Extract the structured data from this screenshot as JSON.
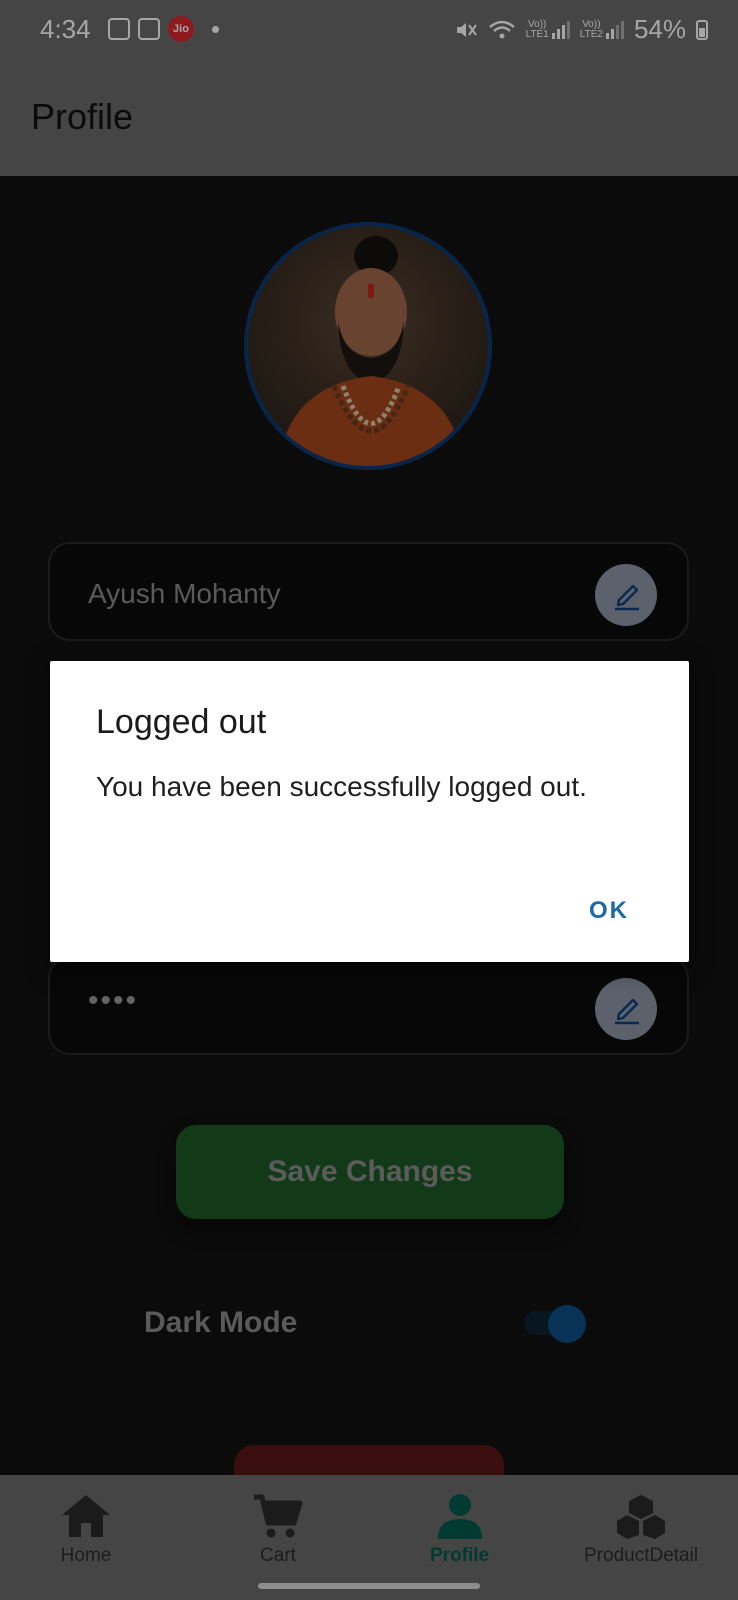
{
  "status_bar": {
    "time": "4:34",
    "battery_percent": "54%",
    "network_1_top": "Vo))",
    "network_1_bottom": "LTE1",
    "network_2_top": "Vo))",
    "network_2_bottom": "LTE2",
    "carrier_badge": "Jio"
  },
  "header": {
    "title": "Profile"
  },
  "profile": {
    "name_value": "Ayush Mohanty",
    "password_masked": "••••"
  },
  "actions": {
    "save_label": "Save Changes"
  },
  "settings": {
    "dark_mode_label": "Dark Mode",
    "dark_mode_on": true
  },
  "dialog": {
    "title": "Logged out",
    "message": "You have been successfully logged out.",
    "ok_label": "OK"
  },
  "bottom_nav": {
    "items": [
      {
        "label": "Home",
        "icon": "home-icon",
        "active": false
      },
      {
        "label": "Cart",
        "icon": "cart-icon",
        "active": false
      },
      {
        "label": "Profile",
        "icon": "person-icon",
        "active": true
      },
      {
        "label": "ProductDetail",
        "icon": "cubes-icon",
        "active": false
      }
    ]
  },
  "colors": {
    "accent_blue": "#1b6aa6",
    "active_nav": "#005a4b",
    "save_green": "#1e5a25"
  }
}
